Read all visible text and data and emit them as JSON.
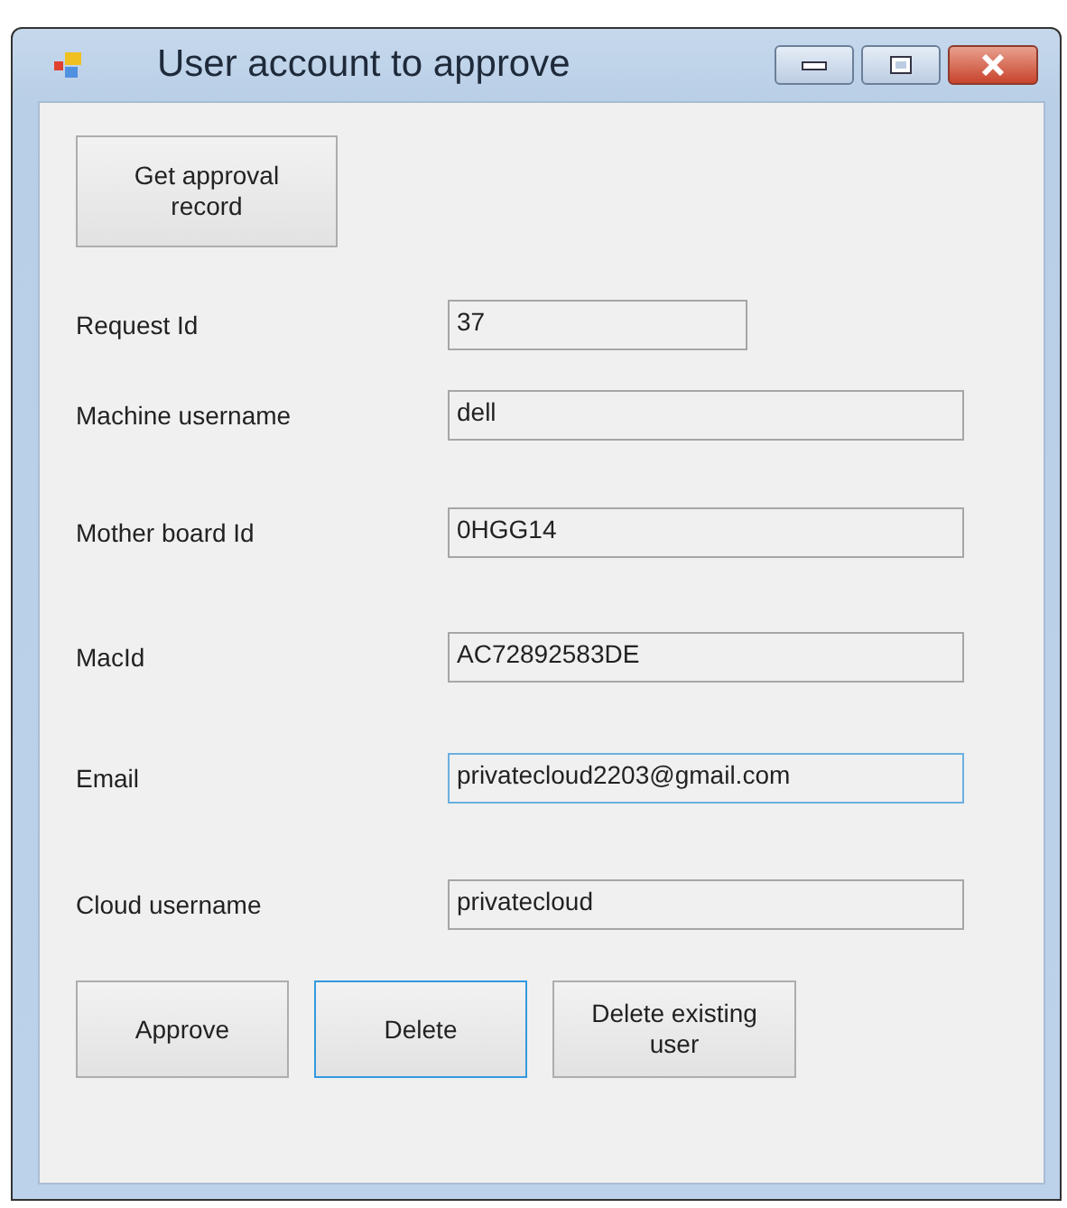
{
  "window": {
    "title": "User account to approve"
  },
  "top_button": {
    "label": "Get approval\nrecord",
    "focused": false
  },
  "fields": [
    {
      "label": "Request Id",
      "value": "37",
      "focused": false
    },
    {
      "label": "Machine username",
      "value": "dell",
      "focused": false
    },
    {
      "label": "Mother board Id",
      "value": "0HGG14",
      "focused": false
    },
    {
      "label": "MacId",
      "value": "AC72892583DE",
      "focused": false
    },
    {
      "label": "Email",
      "value": "privatecloud2203@gmail.com",
      "focused": true
    },
    {
      "label": "Cloud username",
      "value": "privatecloud",
      "focused": false
    }
  ],
  "buttons": [
    {
      "label": "Approve",
      "focused": false
    },
    {
      "label": "Delete",
      "focused": true
    },
    {
      "label": "Delete existing\nuser",
      "focused": false
    }
  ]
}
